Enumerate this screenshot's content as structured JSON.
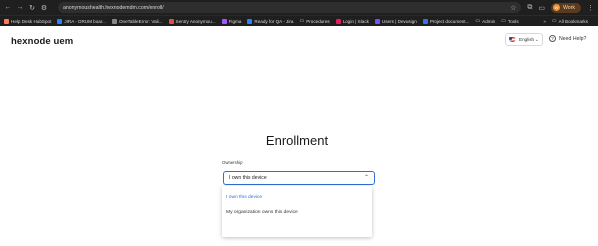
{
  "browser": {
    "url": "anonymoushealth.hexnodemdm.com/enroll/",
    "profile_label": "Work",
    "profile_initials": "W"
  },
  "bookmarks": [
    {
      "label": "Help Desk HubSpot",
      "color": "#ff7a59"
    },
    {
      "label": "JIRA - DRUM boar...",
      "color": "#2684ff"
    },
    {
      "label": "OneTableError: Vali...",
      "color": "#888888"
    },
    {
      "label": "Sentry Anonymou...",
      "color": "#e34c4c"
    },
    {
      "label": "Figma",
      "color": "#a259ff"
    },
    {
      "label": "Ready for QA - Jira",
      "color": "#2684ff"
    },
    {
      "label": "Procedures",
      "color": "folder"
    },
    {
      "label": "Login | Slack",
      "color": "#e01e5a"
    },
    {
      "label": "Users | Devusign",
      "color": "#7b4dff"
    },
    {
      "label": "Project document...",
      "color": "#3b6ef0"
    },
    {
      "label": "Admin",
      "color": "folder"
    },
    {
      "label": "Tools",
      "color": "folder"
    }
  ],
  "bookmarks_more": "»",
  "bookmarks_all": "All Bookmarks",
  "header": {
    "logo": "hexnode uem",
    "language": "English",
    "help": "Need Help?"
  },
  "main": {
    "title": "Enrollment",
    "ownership_label": "Ownership",
    "selected_value": "I own this device",
    "options": [
      "I own this device",
      "My organization owns this device"
    ]
  },
  "colors": {
    "accent": "#2f6fd6",
    "chrome_bg": "#1f1f1f"
  }
}
